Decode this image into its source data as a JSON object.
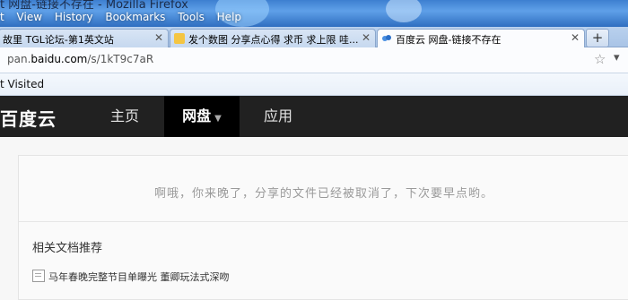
{
  "window": {
    "title": "t 网盘-链接不存在 - Mozilla Firefox"
  },
  "menu": {
    "items": [
      "t",
      "View",
      "History",
      "Bookmarks",
      "Tools",
      "Help"
    ]
  },
  "tabs": [
    {
      "label": "故里 TGL论坛-第1英文站",
      "active": false
    },
    {
      "label": "发个数图 分享点心得 求币 求上限 哇...",
      "active": false
    },
    {
      "label": "百度云 网盘-链接不存在",
      "active": true
    }
  ],
  "newtab": {
    "label": "+"
  },
  "address": {
    "url_prefix": "pan.",
    "url_domain": "baidu.com",
    "url_path": "/s/1kT9c7aR"
  },
  "bookmarks": {
    "most_visited": "t Visited"
  },
  "baidu": {
    "logo": "百度云",
    "nav": [
      {
        "label": "主页",
        "active": false
      },
      {
        "label": "网盘",
        "active": true
      },
      {
        "label": "应用",
        "active": false
      }
    ]
  },
  "content": {
    "message": "啊哦，你来晚了，分享的文件已经被取消了，下次要早点哟。",
    "related_title": "相关文档推荐",
    "related_docs": [
      "马年春晚完整节目单曝光 董卿玩法式深吻"
    ]
  },
  "colors": {
    "baidu_header": "#212121",
    "baidu_nav_active": "#000000",
    "message_text": "#9a9a9a"
  }
}
